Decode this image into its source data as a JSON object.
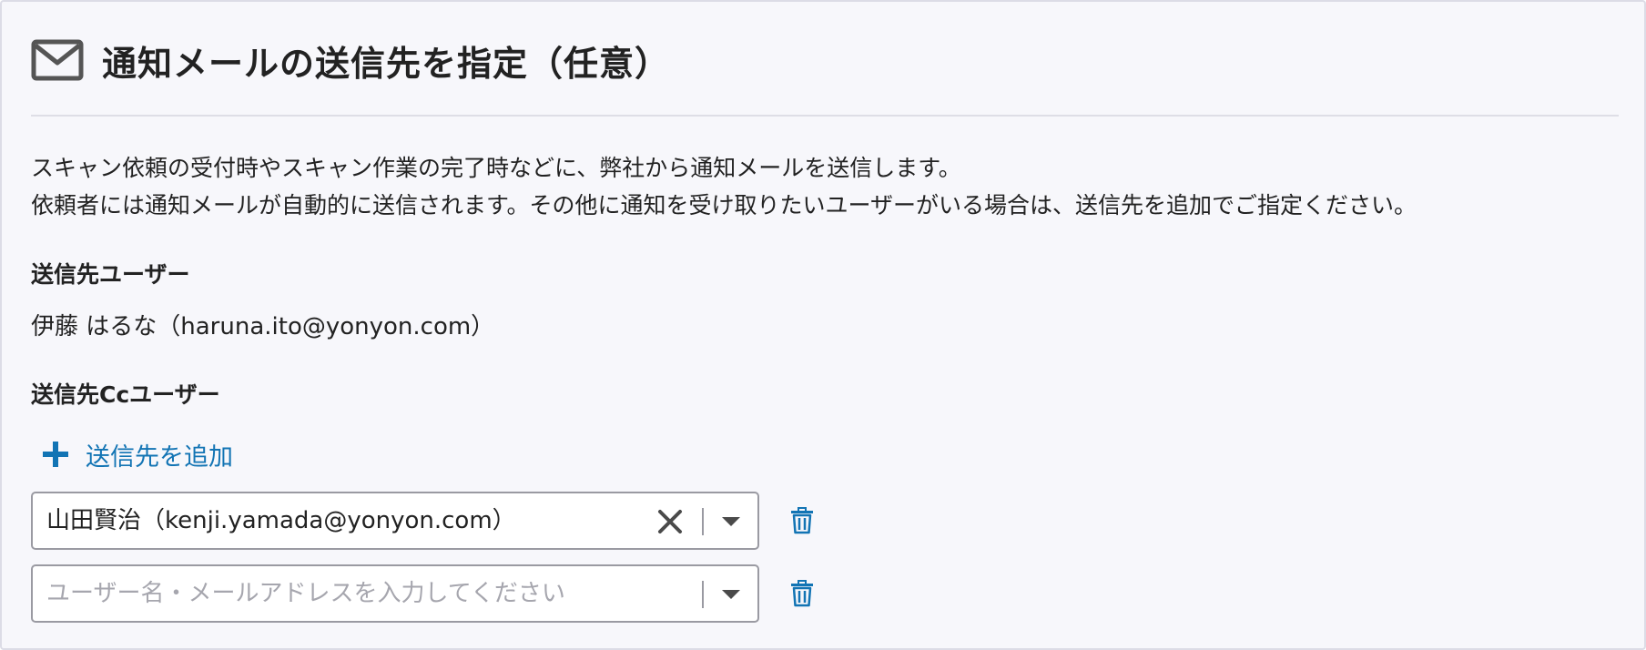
{
  "header": {
    "icon": "mail-icon",
    "title": "通知メールの送信先を指定（任意）"
  },
  "description": {
    "line1": "スキャン依頼の受付時やスキャン作業の完了時などに、弊社から通知メールを送信します。",
    "line2": "依頼者には通知メールが自動的に送信されます。その他に通知を受け取りたいユーザーがいる場合は、送信先を追加でご指定ください。"
  },
  "to_section": {
    "label": "送信先ユーザー",
    "value": "伊藤 はるな（haruna.ito@yonyon.com）"
  },
  "cc_section": {
    "label": "送信先Ccユーザー",
    "add_button": {
      "icon": "plus-icon",
      "label": "送信先を追加"
    },
    "rows": [
      {
        "value": "山田賢治（kenji.yamada@yonyon.com）",
        "placeholder": ""
      },
      {
        "value": "",
        "placeholder": "ユーザー名・メールアドレスを入力してください"
      }
    ]
  },
  "colors": {
    "panel_background": "#f7f7fb",
    "accent_blue": "#1274b4",
    "icon_gray": "#555555",
    "input_border": "#9a9aa2"
  }
}
